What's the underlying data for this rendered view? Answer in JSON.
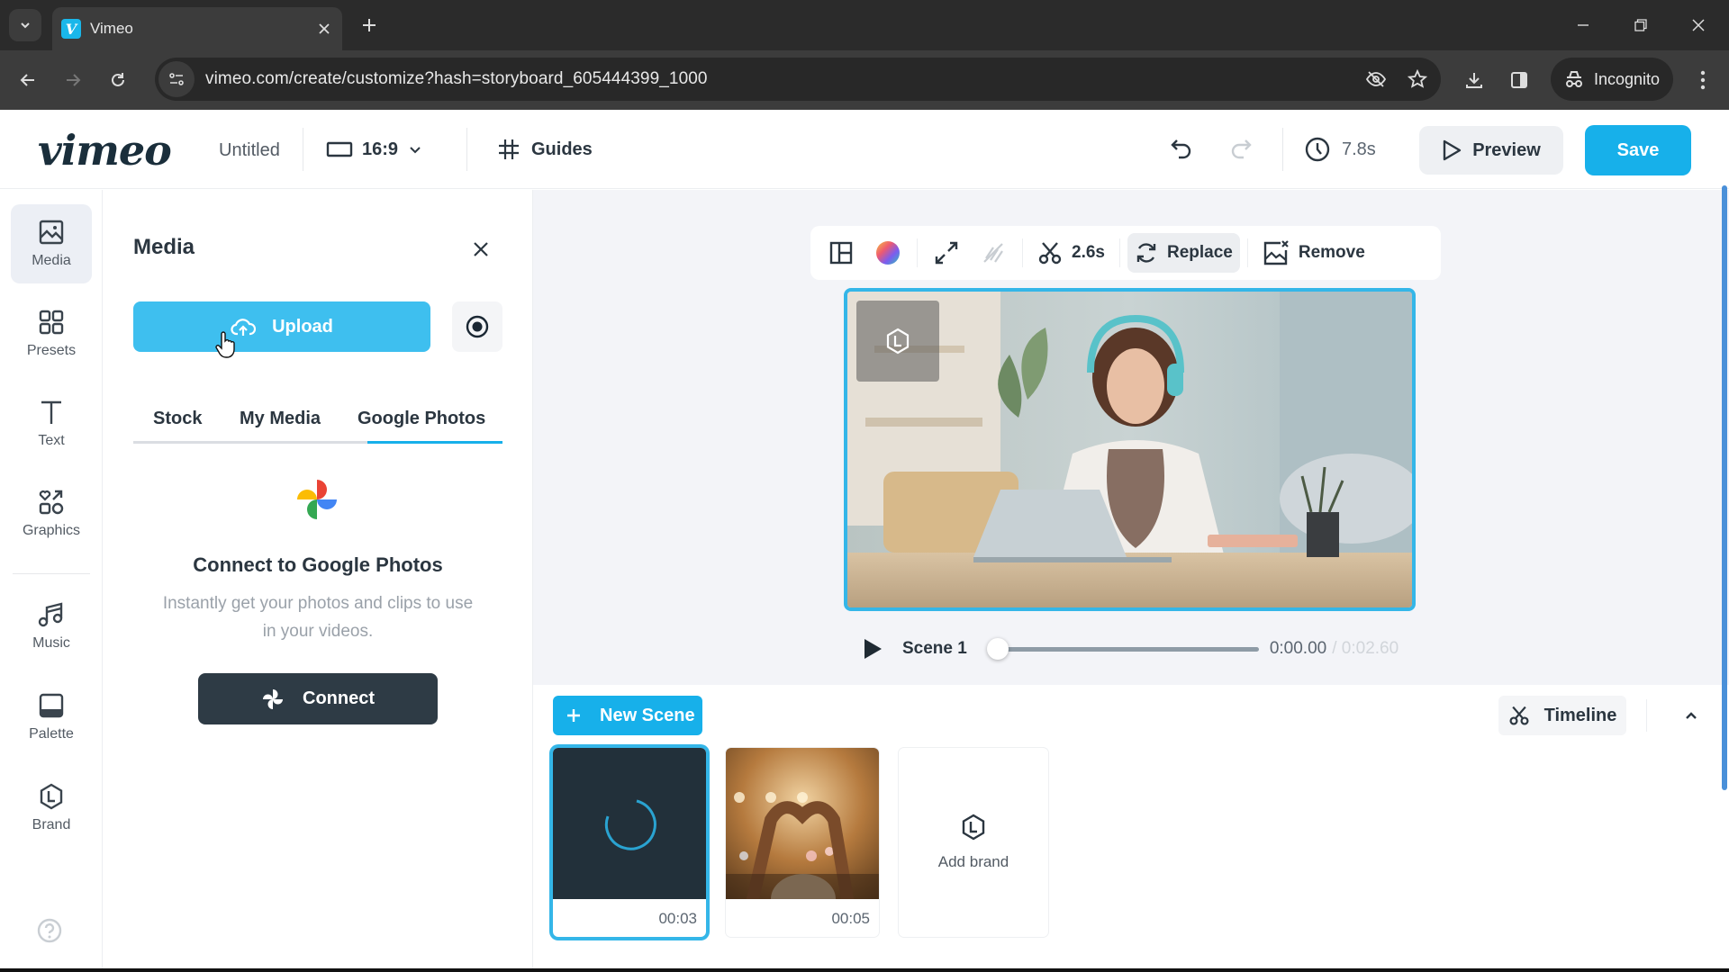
{
  "browser": {
    "tab_title": "Vimeo",
    "favicon_letter": "V",
    "url": "vimeo.com/create/customize?hash=storyboard_605444399_1000",
    "profile_label": "Incognito"
  },
  "header": {
    "logo": "vimeo",
    "doc_title": "Untitled",
    "aspect_ratio": "16:9",
    "guides_label": "Guides",
    "total_duration": "7.8s",
    "preview_label": "Preview",
    "save_label": "Save"
  },
  "rail": {
    "items": [
      {
        "label": "Media",
        "icon": "image-icon",
        "active": true
      },
      {
        "label": "Presets",
        "icon": "grid-icon"
      },
      {
        "label": "Text",
        "icon": "text-icon"
      },
      {
        "label": "Graphics",
        "icon": "graphics-icon"
      },
      {
        "label": "Music",
        "icon": "music-icon"
      },
      {
        "label": "Palette",
        "icon": "palette-icon"
      },
      {
        "label": "Brand",
        "icon": "brand-icon"
      }
    ]
  },
  "panel": {
    "title": "Media",
    "upload_label": "Upload",
    "tabs": [
      {
        "label": "Stock"
      },
      {
        "label": "My Media"
      },
      {
        "label": "Google Photos",
        "active": true
      }
    ],
    "connect_heading": "Connect to Google Photos",
    "connect_description": "Instantly get your photos and clips to use in your videos.",
    "connect_label": "Connect"
  },
  "toolbar": {
    "trim_duration": "2.6s",
    "replace_label": "Replace",
    "remove_label": "Remove"
  },
  "player": {
    "scene_label": "Scene 1",
    "current_time": "0:00.00",
    "total_time": "/ 0:02.60",
    "progress": 0
  },
  "storyboard": {
    "new_scene_label": "New Scene",
    "timeline_label": "Timeline",
    "scenes": [
      {
        "duration": "00:03",
        "state": "loading",
        "selected": true
      },
      {
        "duration": "00:05",
        "state": "image"
      }
    ],
    "add_brand_label": "Add brand"
  },
  "colors": {
    "accent": "#17b0ea",
    "dark": "#2e3b45"
  }
}
